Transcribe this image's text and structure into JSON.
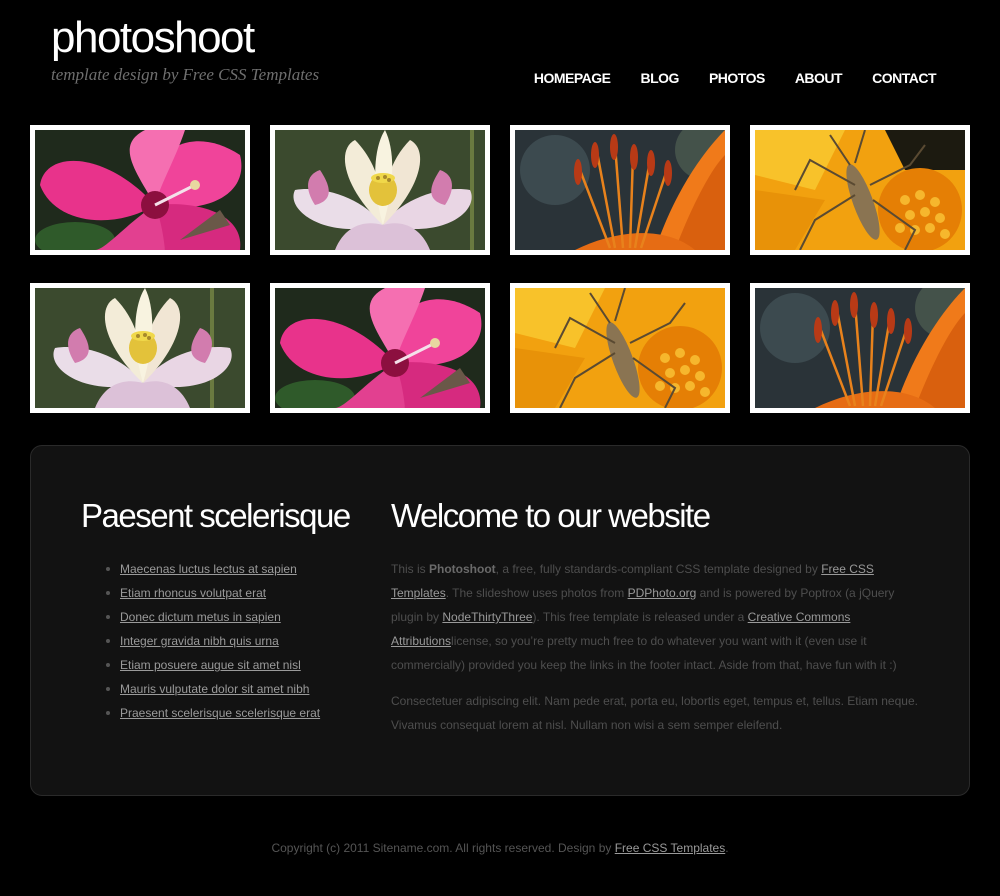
{
  "header": {
    "logo_title": "photoshoot",
    "logo_subtitle": "template design by",
    "logo_credit": "Free CSS Templates"
  },
  "menu": {
    "items": [
      {
        "label": "HOMEPAGE"
      },
      {
        "label": "BLOG"
      },
      {
        "label": "PHOTOS"
      },
      {
        "label": "ABOUT"
      },
      {
        "label": "CONTACT"
      }
    ]
  },
  "gallery": {
    "photos": [
      {
        "subject": "pink-hibiscus"
      },
      {
        "subject": "white-lotus"
      },
      {
        "subject": "lily-stamens"
      },
      {
        "subject": "insect-on-yellow-flower"
      },
      {
        "subject": "white-lotus"
      },
      {
        "subject": "pink-hibiscus"
      },
      {
        "subject": "insect-on-yellow-flower"
      },
      {
        "subject": "lily-stamens"
      }
    ]
  },
  "sidebar": {
    "title": "Paesent scelerisque",
    "links": [
      {
        "label": "Maecenas luctus lectus at sapien"
      },
      {
        "label": "Etiam rhoncus volutpat erat"
      },
      {
        "label": "Donec dictum metus in sapien"
      },
      {
        "label": "Integer gravida nibh quis urna"
      },
      {
        "label": "Etiam posuere augue sit amet nisl"
      },
      {
        "label": "Mauris vulputate dolor sit amet nibh"
      },
      {
        "label": "Praesent scelerisque scelerisque erat"
      }
    ]
  },
  "content": {
    "title": "Welcome to our website",
    "p1_a": "This is ",
    "p1_b": "Photoshoot",
    "p1_c": ", a free, fully standards-compliant CSS template designed by",
    "p1_link1": "Free CSS Templates",
    "p1_d": ". The slideshow uses photos from",
    "p1_link2": "PDPhoto.org",
    "p1_e": " and is powered by Poptrox (a jQuery plugin by",
    "p1_link3": "NodeThirtyThree",
    "p1_f": "). This free template is released under a",
    "p1_link4": "Creative Commons Attributions",
    "p1_g": "license, so you’re pretty much free to do whatever you want with it (even use it commercially) provided you keep the links in the footer intact. Aside from that, have fun with it :)",
    "p2": "Consectetuer adipiscing elit. Nam pede erat, porta eu, lobortis eget, tempus et, tellus. Etiam neque. Vivamus consequat lorem at nisl. Nullam non wisi a sem semper eleifend."
  },
  "footer": {
    "text": "Copyright (c) 2011 Sitename.com. All rights reserved. Design by",
    "link": "Free CSS Templates",
    "end": "."
  },
  "colors": {
    "background": "#000000",
    "panel": "#121212",
    "heading": "#ffffff",
    "link": "#9a9a9a"
  }
}
